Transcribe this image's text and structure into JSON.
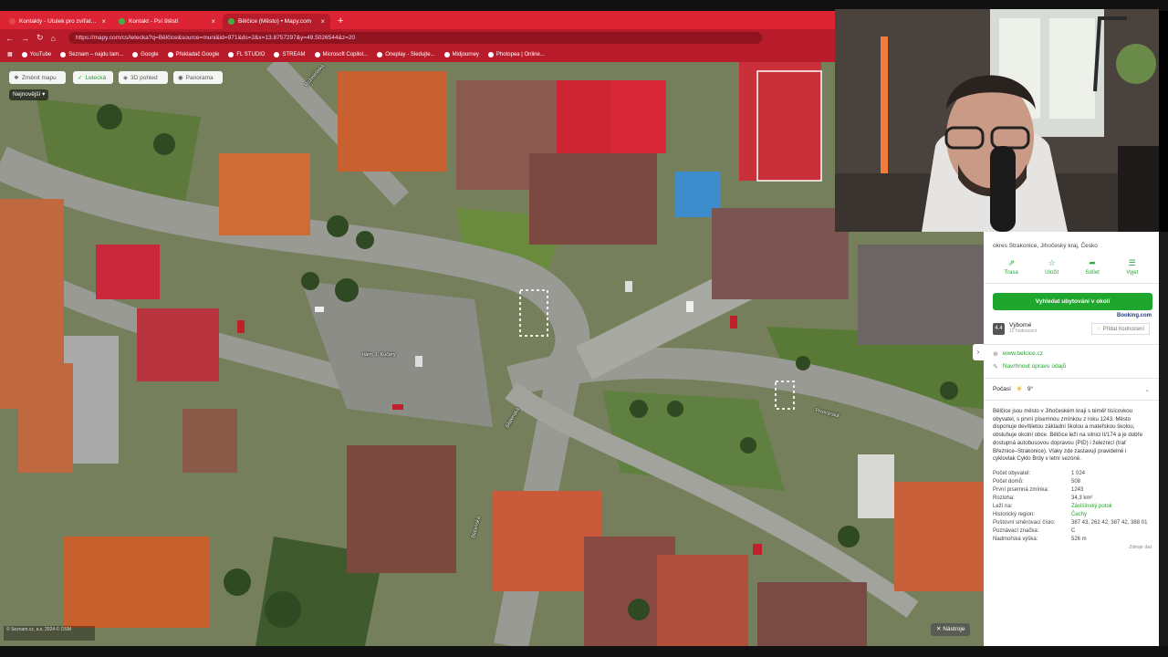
{
  "browser": {
    "tabs": [
      {
        "label": "Kontakty - Útulek pro zvířata v nou",
        "fav_color": "#e04a4a",
        "active": false
      },
      {
        "label": "Kontakt - Psí štěstí",
        "fav_color": "#3fb04a",
        "active": false
      },
      {
        "label": "Bělčice (Město) • Mapy.com",
        "fav_color": "#40b040",
        "active": true
      }
    ],
    "url": "https://mapy.com/cs/letecka?q=Bělčice&source=muni&id=971&ds=2&x=13.8757297&y=49.5026544&z=20",
    "bookmarks": [
      "YouTube",
      "Seznam – najdu tam...",
      "Google",
      "Překladač Google",
      "FL STUDIO",
      "STREAM",
      "Microsoft Copilot...",
      "Oneplay - Sledujte...",
      "Midjourney",
      "Photopea | Online..."
    ]
  },
  "map": {
    "buttons": [
      {
        "label": "Změnit mapu",
        "active": false
      },
      {
        "label": "Letecká",
        "active": true
      },
      {
        "label": "3D pohled",
        "active": false
      },
      {
        "label": "Panorama",
        "active": false
      }
    ],
    "sort_label": "Nejnovější",
    "street_labels": [
      "Rožmitálská",
      "nám. J. Kučery",
      "Blatenská",
      "Blatenská",
      "Pivovarská",
      "Zámecká"
    ],
    "tools_label": "Nástroje",
    "scale_text": "© Seznam.cz, a.s. 2024 © OSM"
  },
  "panel": {
    "region": "okres Strakonice, Jihočeský kraj, Česko",
    "actions": [
      "Trasa",
      "Uložit",
      "Sdílet",
      "Vyjet"
    ],
    "search_lodging": "Vyhledat ubytování v okolí",
    "booking": "Booking.com",
    "rating": {
      "score": "4.4",
      "label": "Výborné",
      "count": "12 hodnocení",
      "add": "Přidat hodnocení"
    },
    "web": "www.belcice.cz",
    "suggest_edit": "Navrhnout úpravu údajů",
    "weather": {
      "label": "Počasí",
      "temp": "9°"
    },
    "description": "Bělčice jsou město v Jihočeském kraji s téměř tisícovkou obyvatel, s první písemnou zmínkou z roku 1243. Město disponuje devítiletou základní školou a mateřskou školou, obsluhuje okolní obce. Bělčice leží na silnici II/174 a je dobře dostupná autobusovou dopravou (PID) i železnicí (trať Březnice–Strakonice). Vlaky zde zastavují pravidelně i cyklovlak Cyklo Brdy v letní sezóně.",
    "facts": [
      {
        "k": "Počet obyvatel:",
        "v": "1 024",
        "link": false
      },
      {
        "k": "Počet domů:",
        "v": "508",
        "link": false
      },
      {
        "k": "První písemná zmínka:",
        "v": "1243",
        "link": false
      },
      {
        "k": "Rozloha:",
        "v": "34,3 km²",
        "link": false
      },
      {
        "k": "Leží na:",
        "v": "Závišínský potok",
        "link": true
      },
      {
        "k": "Historický region:",
        "v": "Čechy",
        "link": true
      },
      {
        "k": "Poštovní směrovací číslo:",
        "v": "387 43, 262 42, 387 42, 388 01",
        "link": false
      },
      {
        "k": "Poznávací značka:",
        "v": "C",
        "link": false
      },
      {
        "k": "Nadmořská výška:",
        "v": "526 m",
        "link": false
      }
    ],
    "source": "Zdroje dat"
  }
}
